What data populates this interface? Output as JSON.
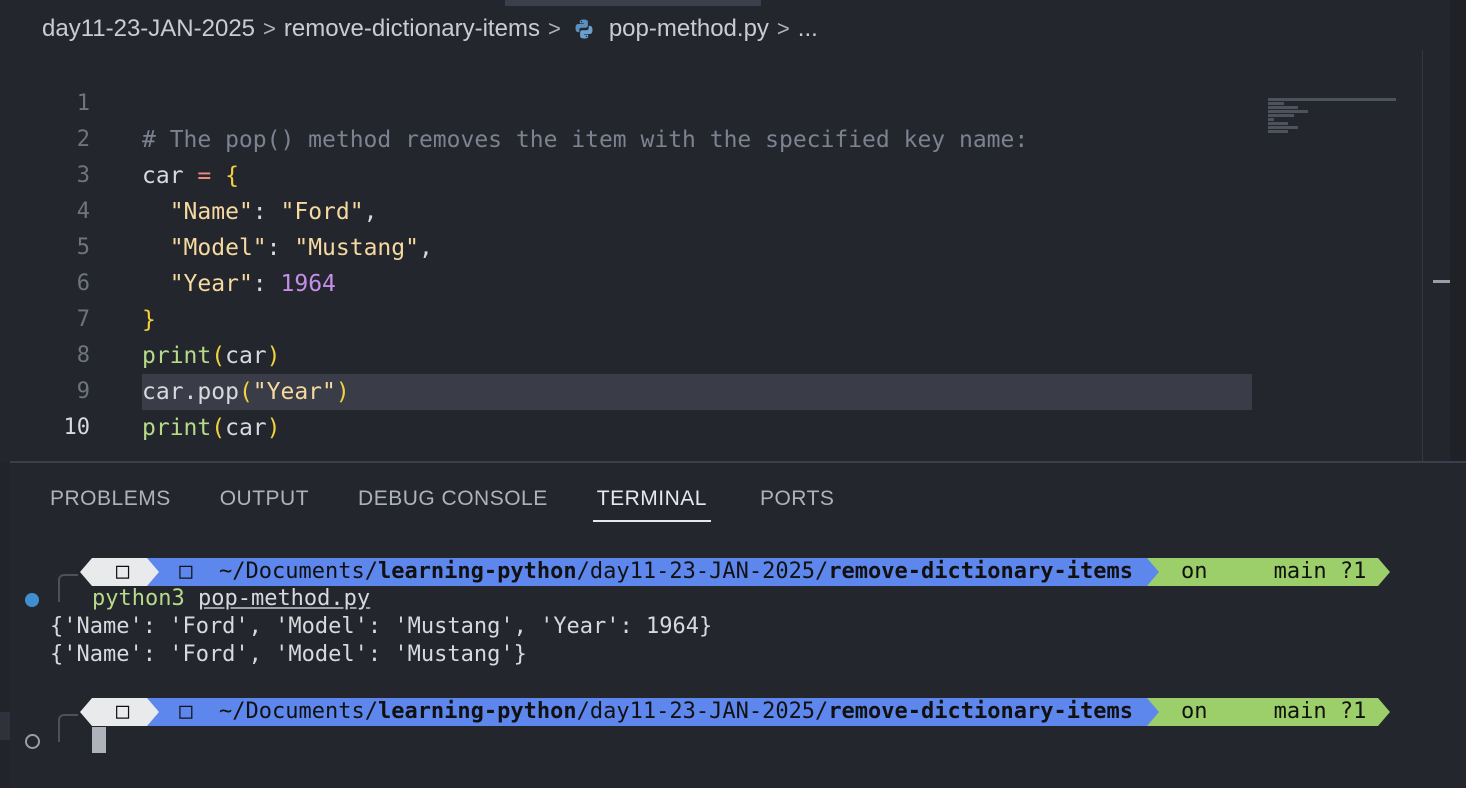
{
  "breadcrumb": {
    "folder": "day11-23-JAN-2025",
    "subfolder": "remove-dictionary-items",
    "file": "pop-method.py",
    "more": "..."
  },
  "editor": {
    "lines": [
      {
        "num": "1",
        "text": "# The pop() method removes the item with the specified key name:"
      },
      {
        "num": "2",
        "text": "car = {"
      },
      {
        "num": "3",
        "text": "  \"Name\": \"Ford\","
      },
      {
        "num": "4",
        "text": "  \"Model\": \"Mustang\","
      },
      {
        "num": "5",
        "text": "  \"Year\": 1964"
      },
      {
        "num": "6",
        "text": "}"
      },
      {
        "num": "7",
        "text": "print(car)"
      },
      {
        "num": "8",
        "text": "car.pop(\"Year\")"
      },
      {
        "num": "9",
        "text": "print(car)"
      },
      {
        "num": "10",
        "text": ""
      }
    ],
    "active_line": "10"
  },
  "panel": {
    "tabs": [
      "PROBLEMS",
      "OUTPUT",
      "DEBUG CONSOLE",
      "TERMINAL",
      "PORTS"
    ],
    "active_tab": "TERMINAL"
  },
  "terminal": {
    "prompt": {
      "dir_prefix": "~/Documents/",
      "dir_bold1": "learning-python",
      "dir_mid": "/day11-23-JAN-2025/",
      "dir_bold2": "remove-dictionary-items",
      "git": "on     main ?1"
    },
    "command_program": "python3",
    "command_file": "pop-method.py",
    "output": [
      "{'Name': 'Ford', 'Model': 'Mustang', 'Year': 1964}",
      "{'Name': 'Ford', 'Model': 'Mustang'}"
    ]
  },
  "colors": {
    "background": "#24262d",
    "prompt_os": "#e9eaec",
    "prompt_dir": "#5e87ee",
    "prompt_git": "#9ccf6a",
    "status_dot": "#3f8fd2"
  }
}
